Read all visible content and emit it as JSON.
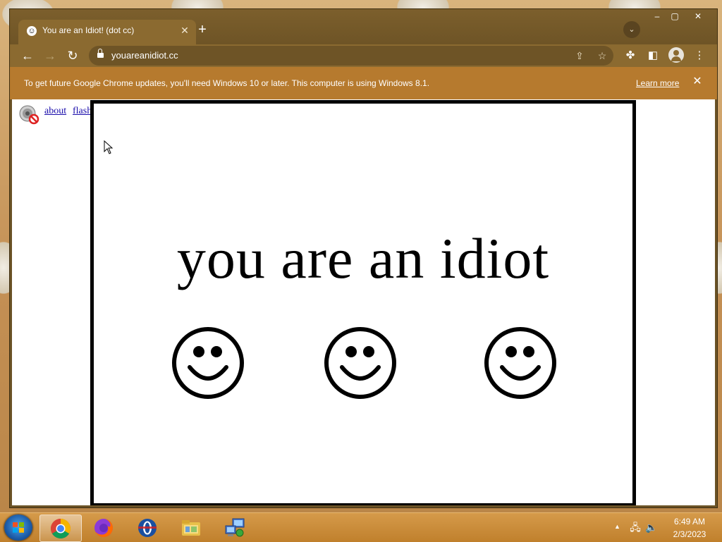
{
  "browser": {
    "tab_title": "You are an Idiot! (dot cc)",
    "tab_favicon": "smiley-face-icon",
    "new_tab_glyph": "+",
    "tab_close_glyph": "✕",
    "window_controls": {
      "minimize": "–",
      "maximize": "▢",
      "close": "✕"
    },
    "url": "youareanidiot.cc",
    "nav_icons": [
      "back-icon",
      "forward-icon",
      "reload-icon"
    ],
    "toolbar_icons": [
      "share-icon",
      "bookmark-star-icon",
      "extensions-icon",
      "side-panel-icon",
      "profile-icon",
      "menu-icon"
    ]
  },
  "infobar": {
    "message": "To get future Google Chrome updates, you'll need Windows 10 or later. This computer is using Windows 8.1.",
    "link": "Learn more",
    "close_glyph": "✕"
  },
  "page": {
    "links": {
      "about": "about",
      "flash": "flash"
    },
    "headline": "you are an idiot",
    "smiley_count": 3
  },
  "taskbar": {
    "apps": [
      "chrome-icon",
      "firefox-icon",
      "opera-icon",
      "file-explorer-icon",
      "remote-desktop-icon"
    ],
    "active_app": "chrome-icon",
    "clock_time": "6:49 AM",
    "clock_date": "2/3/2023"
  },
  "colors": {
    "window_frame": "#6b5326",
    "toolbar": "#8b6a30",
    "infobar": "#b67a2e",
    "taskbar": "#c98c3a",
    "link": "#1a0dab"
  }
}
